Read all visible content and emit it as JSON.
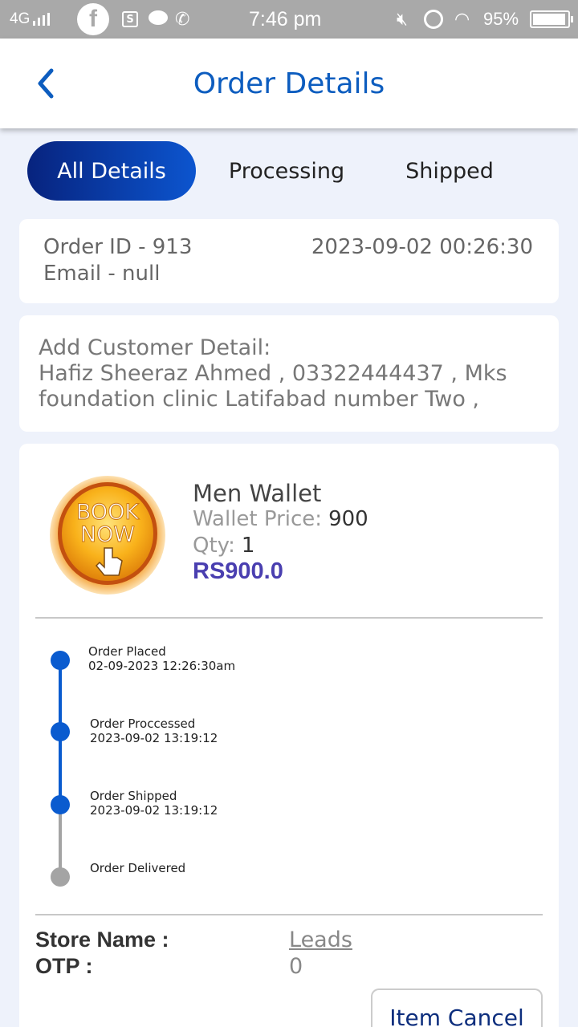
{
  "status_bar": {
    "network": "4G",
    "fb_glyph": "f",
    "s_glyph": "S",
    "time": "7:46 pm",
    "battery": "95%",
    "battery_level": 0.95,
    "icons": [
      "signal-icon",
      "facebook-icon",
      "s-app-icon",
      "chat-icon",
      "phone-icon",
      "mute-icon",
      "alarm-icon",
      "wifi-icon",
      "battery-icon"
    ]
  },
  "header": {
    "title": "Order Details",
    "back_icon": "chevron-left-icon"
  },
  "tabs": [
    {
      "label": "All Details",
      "active": true
    },
    {
      "label": "Processing",
      "active": false
    },
    {
      "label": "Shipped",
      "active": false
    }
  ],
  "order": {
    "id": "Order ID - 913",
    "email": "Email - null",
    "date": "2023-09-02 00:26:30"
  },
  "customer": {
    "label": "Add Customer Detail:",
    "line1": "Hafiz Sheeraz Ahmed ,  03322444437 , Mks",
    "line2": "foundation clinic Latifabad number Two ,"
  },
  "item": {
    "badge_line1": "BOOK",
    "badge_line2": "NOW",
    "name": "Men Wallet",
    "price_label": "Wallet Price:",
    "price_value": "900",
    "qty_label": "Qty:",
    "qty_value": "1",
    "total": "RS900.0"
  },
  "timeline": [
    {
      "title": "Order Placed",
      "time": "02-09-2023 12:26:30am",
      "done": true
    },
    {
      "title": "Order Proccessed",
      "time": "2023-09-02 13:19:12",
      "done": true
    },
    {
      "title": "Order Shipped",
      "time": "2023-09-02 13:19:12",
      "done": true
    },
    {
      "title": "Order Delivered",
      "time": "",
      "done": false
    }
  ],
  "store": {
    "store_label": "Store Name :",
    "store_value": "Leads",
    "otp_label": "OTP :",
    "otp_value": "0"
  },
  "actions": {
    "cancel_label": "Item Cancel"
  },
  "colors": {
    "accent": "#0d5dbf",
    "tab_gradient_start": "#07237e",
    "tab_gradient_end": "#0c55cf",
    "timeline_done": "#0a5bcf",
    "timeline_pending": "#a4a4a4",
    "total_price": "#4a3fb0",
    "background": "#eef2fb"
  }
}
